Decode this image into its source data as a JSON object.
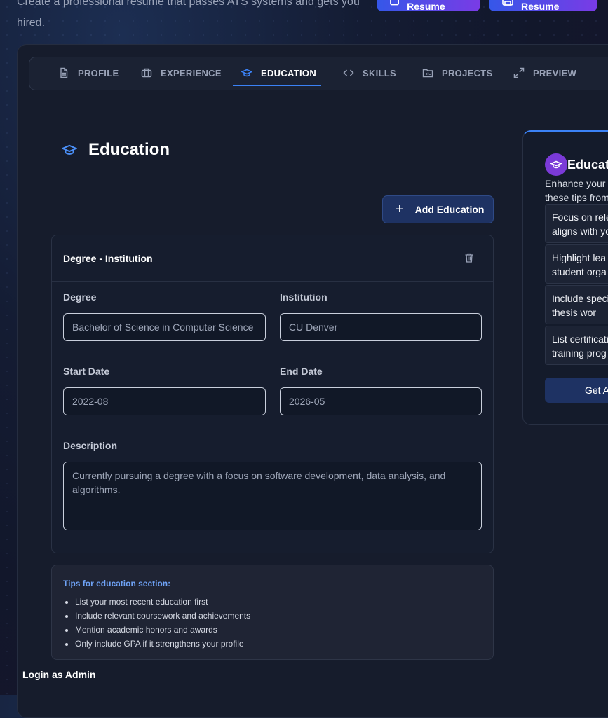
{
  "header": {
    "subtitle": "Create a professional resume that passes ATS systems and gets you hired.",
    "load_label": "Load Resume",
    "save_label": "Save Resume"
  },
  "tabs": [
    {
      "label": "PROFILE",
      "icon": "file-icon"
    },
    {
      "label": "EXPERIENCE",
      "icon": "briefcase-icon"
    },
    {
      "label": "EDUCATION",
      "icon": "graduation-cap-icon",
      "active": true
    },
    {
      "label": "SKILLS",
      "icon": "code-icon"
    },
    {
      "label": "PROJECTS",
      "icon": "folder-icon"
    },
    {
      "label": "PREVIEW",
      "icon": "expand-icon"
    }
  ],
  "section": {
    "title": "Education",
    "add_label": "Add Education"
  },
  "entry": {
    "title": "Degree - Institution",
    "degree_label": "Degree",
    "degree_value": "Bachelor of Science in Computer Science",
    "institution_label": "Institution",
    "institution_value": "CU Denver",
    "start_label": "Start Date",
    "start_value": "2022-08",
    "end_label": "End Date",
    "end_value": "2026-05",
    "description_label": "Description",
    "description_value": "Currently pursuing a degree with a focus on software development, data analysis, and algorithms."
  },
  "tips": {
    "title": "Tips for education section:",
    "items": [
      "List your most recent education first",
      "Include relevant coursework and achievements",
      "Mention academic honors and awards",
      "Only include GPA if it strengthens your profile"
    ]
  },
  "side": {
    "title": "Educati",
    "intro": "Enhance your e these tips from",
    "tips": [
      "Focus on rele aligns with yo",
      "Highlight lea student orga",
      "Include speci or thesis wor",
      "List certificati training prog"
    ],
    "button_label": "Get A"
  },
  "footer": {
    "admin_label": "Login as Admin"
  },
  "colors": {
    "accent": "#3b82f6",
    "button_gradient_start": "#3557e8",
    "button_gradient_end": "#7a3be6",
    "side_icon_bg": "#7b3ad8"
  }
}
